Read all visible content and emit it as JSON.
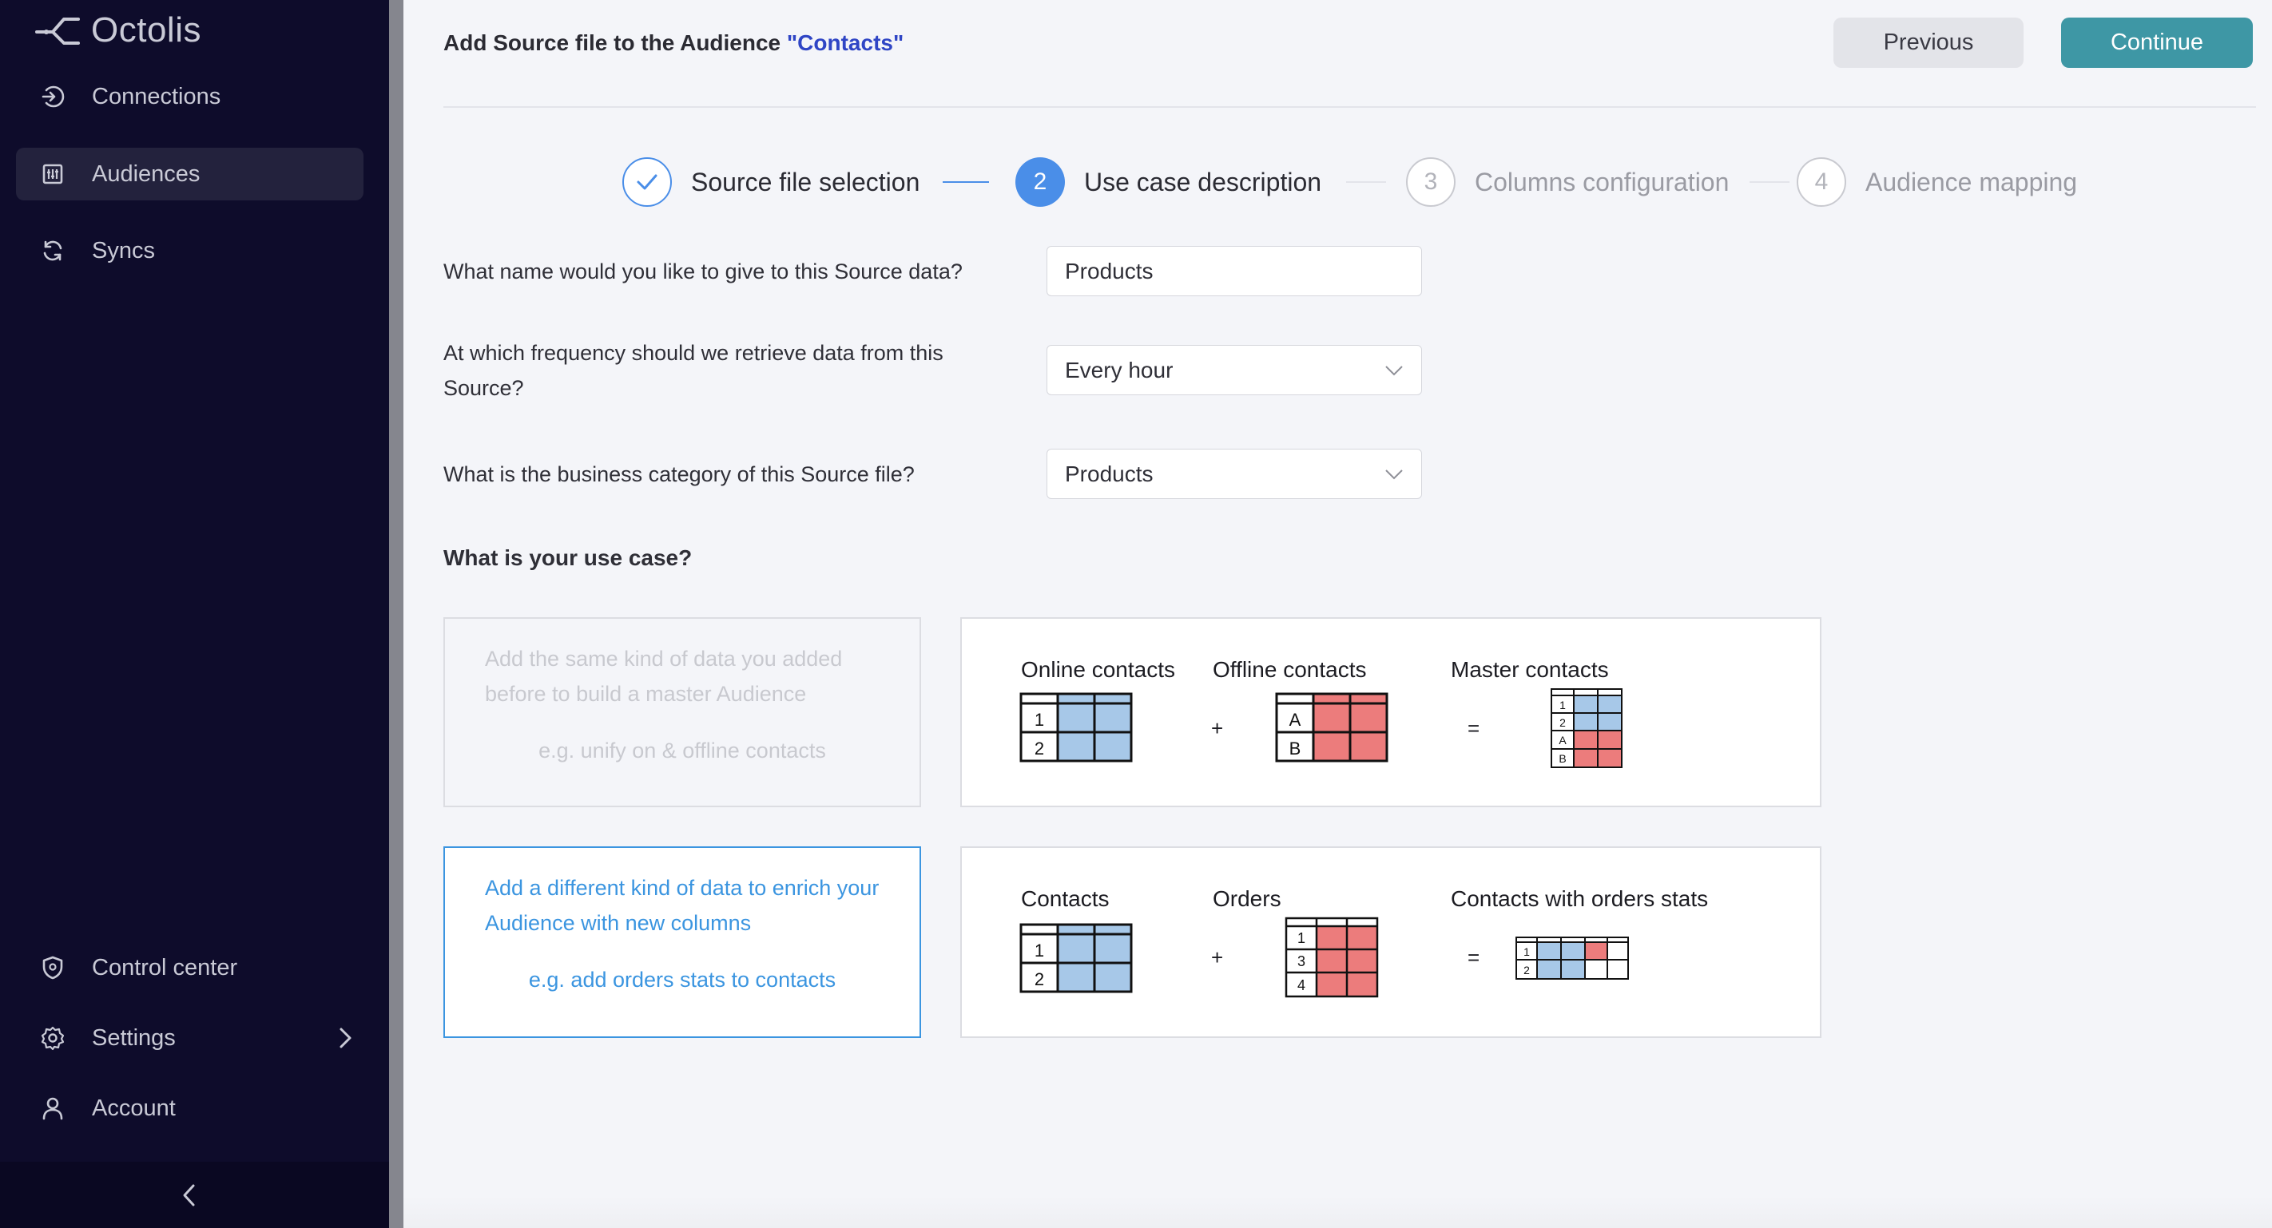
{
  "sidebar": {
    "brand": "Octolis",
    "items": [
      {
        "label": "Connections",
        "icon": "connections-icon",
        "active": false
      },
      {
        "label": "Audiences",
        "icon": "audiences-icon",
        "active": true
      },
      {
        "label": "Syncs",
        "icon": "sync-icon",
        "active": false
      }
    ],
    "bottom_items": [
      {
        "label": "Control center",
        "icon": "shield-icon"
      },
      {
        "label": "Settings",
        "icon": "gear-icon"
      },
      {
        "label": "Account",
        "icon": "user-icon"
      }
    ]
  },
  "header": {
    "title_prefix": "Add Source file to the Audience ",
    "audience_name": "\"Contacts\"",
    "previous_label": "Previous",
    "continue_label": "Continue"
  },
  "stepper": {
    "steps": [
      {
        "number": "",
        "label": "Source file selection",
        "state": "done"
      },
      {
        "number": "2",
        "label": "Use case description",
        "state": "active"
      },
      {
        "number": "3",
        "label": "Columns configuration",
        "state": "todo"
      },
      {
        "number": "4",
        "label": "Audience mapping",
        "state": "todo"
      }
    ]
  },
  "form": {
    "name_question": "What name would you like to give to this Source data?",
    "name_value": "Products",
    "frequency_question": "At which frequency should we retrieve data from this Source?",
    "frequency_value": "Every hour",
    "category_question": "What is the business category of this Source file?",
    "category_value": "Products"
  },
  "use_case": {
    "title": "What is your use case?",
    "options": [
      {
        "text": "Add the same kind of data you added before to build a master Audience",
        "example": "e.g. unify on & offline contacts",
        "selected": false
      },
      {
        "text": "Add a different kind of data to enrich your Audience with new columns",
        "example": "e.g. add orders stats to contacts",
        "selected": true
      }
    ],
    "illustrations": [
      {
        "left": "Online contacts",
        "middle": "Offline contacts",
        "right": "Master contacts",
        "plus": "+",
        "equals": "=",
        "left_rows": [
          "1",
          "2"
        ],
        "middle_rows": [
          "A",
          "B"
        ],
        "right_rows": [
          "1",
          "2",
          "A",
          "B"
        ]
      },
      {
        "left": "Contacts",
        "middle": "Orders",
        "right": "Contacts with orders stats",
        "plus": "+",
        "equals": "=",
        "left_rows": [
          "1",
          "2"
        ],
        "middle_rows": [
          "1",
          "3",
          "4"
        ],
        "right_rows": [
          "1",
          "2"
        ]
      }
    ]
  },
  "colors": {
    "sidebar_bg": "#0e0c2b",
    "accent_blue": "#4a8ee8",
    "continue_bg": "#3e97a5",
    "table_blue": "#a7c8e8",
    "table_red": "#ec7c7c"
  }
}
